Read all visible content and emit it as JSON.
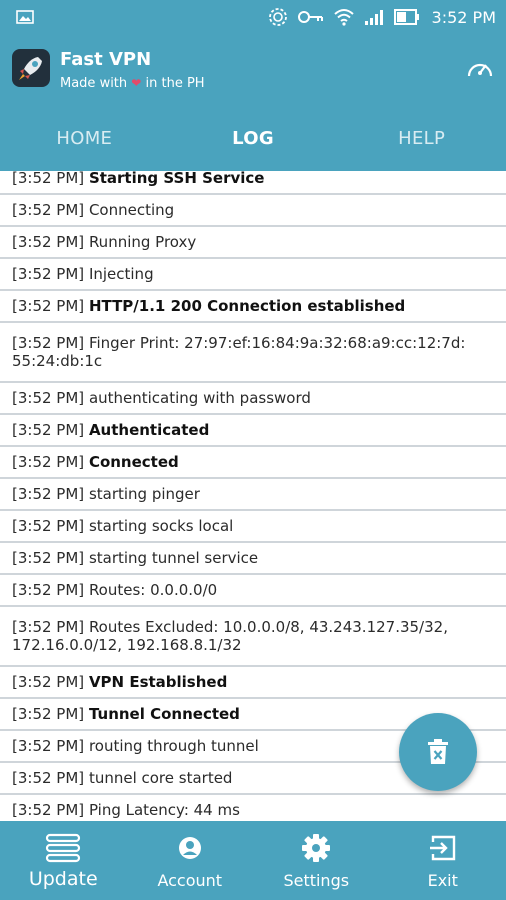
{
  "status_bar": {
    "time": "3:52 PM"
  },
  "app": {
    "title": "Fast VPN",
    "subtitle_pre": "Made with",
    "subtitle_heart": "❤",
    "subtitle_post": "in the PH"
  },
  "tabs": [
    {
      "label": "HOME"
    },
    {
      "label": "LOG"
    },
    {
      "label": "HELP"
    }
  ],
  "log": [
    {
      "time": "[3:52 PM]",
      "msg": "Starting SSH Service",
      "bold": true
    },
    {
      "time": "[3:52 PM]",
      "msg": "Connecting",
      "bold": false
    },
    {
      "time": "[3:52 PM]",
      "msg": "Running Proxy",
      "bold": false
    },
    {
      "time": "[3:52 PM]",
      "msg": "Injecting",
      "bold": false
    },
    {
      "time": "[3:52 PM]",
      "msg": "HTTP/1.1 200 Connection established",
      "bold": true
    },
    {
      "time": "[3:52 PM]",
      "msg": "Finger Print: 27:97:ef:16:84:9a:32:68:a9:cc:12:7d:",
      "msg2": "55:24:db:1c",
      "bold": false
    },
    {
      "time": "[3:52 PM]",
      "msg": "authenticating with password",
      "bold": false
    },
    {
      "time": "[3:52 PM]",
      "msg": "Authenticated",
      "bold": true
    },
    {
      "time": "[3:52 PM]",
      "msg": "Connected",
      "bold": true
    },
    {
      "time": "[3:52 PM]",
      "msg": "starting pinger",
      "bold": false
    },
    {
      "time": "[3:52 PM]",
      "msg": "starting socks local",
      "bold": false
    },
    {
      "time": "[3:52 PM]",
      "msg": "starting tunnel service",
      "bold": false
    },
    {
      "time": "[3:52 PM]",
      "msg": "Routes: 0.0.0.0/0",
      "bold": false
    },
    {
      "time": "[3:52 PM]",
      "msg": "Routes Excluded: 10.0.0.0/8, 43.243.127.35/32,",
      "msg2": "172.16.0.0/12, 192.168.8.1/32",
      "bold": false
    },
    {
      "time": "[3:52 PM]",
      "msg": "VPN Established",
      "bold": true
    },
    {
      "time": "[3:52 PM]",
      "msg": "Tunnel Connected",
      "bold": true
    },
    {
      "time": "[3:52 PM]",
      "msg": "routing through tunnel",
      "bold": false
    },
    {
      "time": "[3:52 PM]",
      "msg": "tunnel core started",
      "bold": false
    },
    {
      "time": "[3:52 PM]",
      "msg": "Ping Latency: 44 ms",
      "bold": false
    }
  ],
  "bottom_nav": [
    {
      "label": "Update",
      "icon": "stack-icon"
    },
    {
      "label": "Account",
      "icon": "account-icon"
    },
    {
      "label": "Settings",
      "icon": "gear-icon"
    },
    {
      "label": "Exit",
      "icon": "exit-icon"
    }
  ],
  "colors": {
    "primary": "#4aa3be",
    "heart": "#e34b6a"
  }
}
